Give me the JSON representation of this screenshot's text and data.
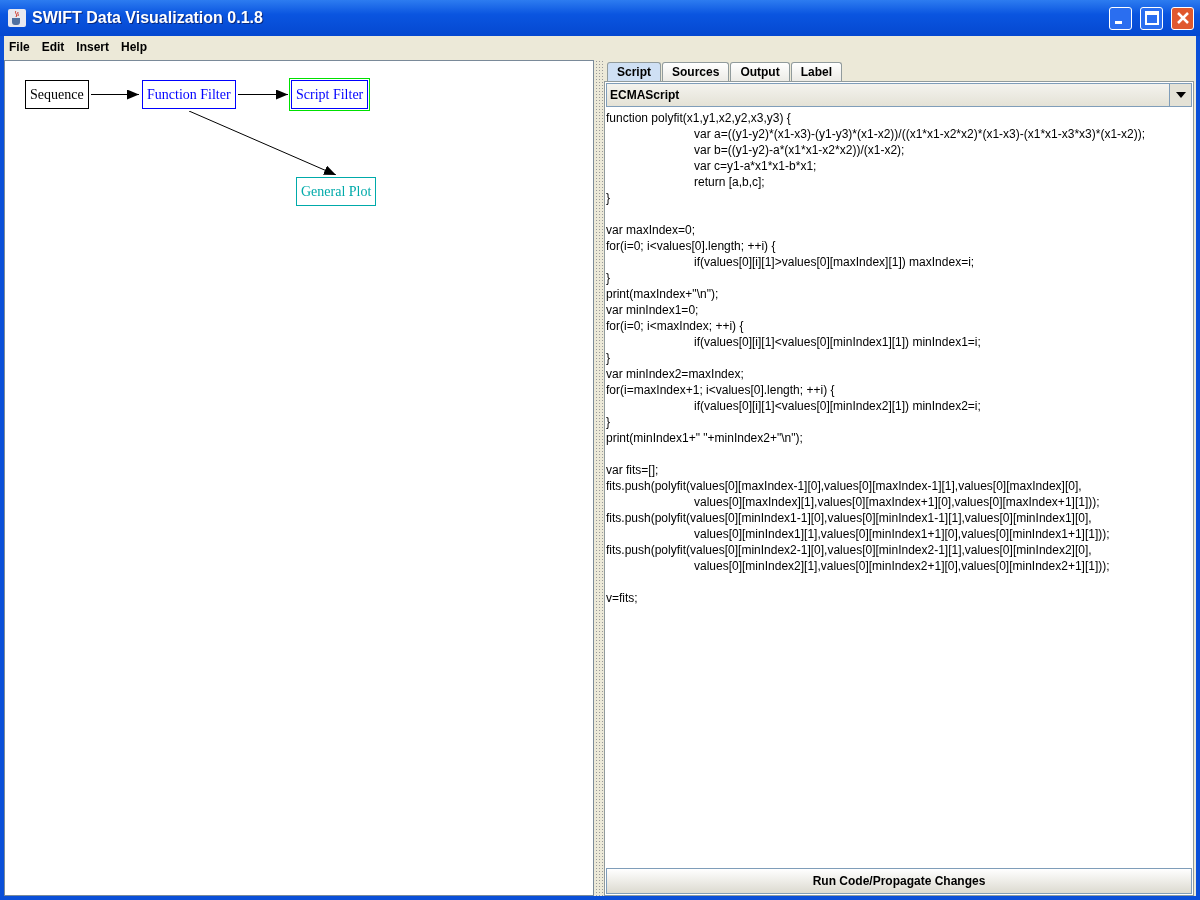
{
  "window": {
    "title": "SWIFT Data Visualization 0.1.8"
  },
  "menu": [
    "File",
    "Edit",
    "Insert",
    "Help"
  ],
  "graph": {
    "nodes": [
      {
        "label": "Sequence",
        "color": "#000000",
        "selected": false
      },
      {
        "label": "Function Filter",
        "color": "#0000ff",
        "selected": false
      },
      {
        "label": "Script Filter",
        "color": "#0000ff",
        "selected": true
      },
      {
        "label": "General Plot",
        "color": "#00aaaa",
        "selected": false
      }
    ]
  },
  "tabs": [
    {
      "label": "Script",
      "selected": true
    },
    {
      "label": "Sources",
      "selected": false
    },
    {
      "label": "Output",
      "selected": false
    },
    {
      "label": "Label",
      "selected": false
    }
  ],
  "language": {
    "value": "ECMAScript"
  },
  "code": [
    [
      {
        "text": "function polyfit(x1,y1,x2,y2,x3,y3) {",
        "indented": false
      },
      {
        "text": "var a=((y1-y2)*(x1-x3)-(y1-y3)*(x1-x2))/((x1*x1-x2*x2)*(x1-x3)-(x1*x1-x3*x3)*(x1-x2));",
        "indented": true
      },
      {
        "text": "var b=((y1-y2)-a*(x1*x1-x2*x2))/(x1-x2);",
        "indented": true
      },
      {
        "text": "var c=y1-a*x1*x1-b*x1;",
        "indented": true
      },
      {
        "text": "return [a,b,c];",
        "indented": true
      },
      {
        "text": "}",
        "indented": false
      }
    ],
    [
      {
        "text": "var maxIndex=0;",
        "indented": false
      },
      {
        "text": "for(i=0; i<values[0].length; ++i) {",
        "indented": false
      },
      {
        "text": "if(values[0][i][1]>values[0][maxIndex][1]) maxIndex=i;",
        "indented": true
      },
      {
        "text": "}",
        "indented": false
      },
      {
        "text": "print(maxIndex+\"\\n\");",
        "indented": false
      },
      {
        "text": "var minIndex1=0;",
        "indented": false
      },
      {
        "text": "for(i=0; i<maxIndex; ++i) {",
        "indented": false
      },
      {
        "text": "if(values[0][i][1]<values[0][minIndex1][1]) minIndex1=i;",
        "indented": true
      },
      {
        "text": "}",
        "indented": false
      },
      {
        "text": "var minIndex2=maxIndex;",
        "indented": false
      },
      {
        "text": "for(i=maxIndex+1; i<values[0].length; ++i) {",
        "indented": false
      },
      {
        "text": "if(values[0][i][1]<values[0][minIndex2][1]) minIndex2=i;",
        "indented": true
      },
      {
        "text": "}",
        "indented": false
      },
      {
        "text": "print(minIndex1+\" \"+minIndex2+\"\\n\");",
        "indented": false
      }
    ],
    [
      {
        "text": "var fits=[];",
        "indented": false
      },
      {
        "text": "fits.push(polyfit(values[0][maxIndex-1][0],values[0][maxIndex-1][1],values[0][maxIndex][0],",
        "indented": false
      },
      {
        "text": "values[0][maxIndex][1],values[0][maxIndex+1][0],values[0][maxIndex+1][1]));",
        "indented": true
      },
      {
        "text": "fits.push(polyfit(values[0][minIndex1-1][0],values[0][minIndex1-1][1],values[0][minIndex1][0],",
        "indented": false
      },
      {
        "text": "values[0][minIndex1][1],values[0][minIndex1+1][0],values[0][minIndex1+1][1]));",
        "indented": true
      },
      {
        "text": "fits.push(polyfit(values[0][minIndex2-1][0],values[0][minIndex2-1][1],values[0][minIndex2][0],",
        "indented": false
      },
      {
        "text": "values[0][minIndex2][1],values[0][minIndex2+1][0],values[0][minIndex2+1][1]));",
        "indented": true
      }
    ],
    [
      {
        "text": "v=fits;",
        "indented": false
      }
    ]
  ],
  "run_button": "Run Code/Propagate Changes"
}
